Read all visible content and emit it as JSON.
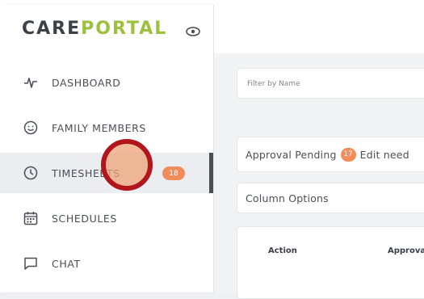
{
  "app": {
    "logo_care": "CARE",
    "logo_portal": "PORTAL",
    "brand_colors": {
      "care": "#3b4148",
      "portal": "#9cc13d"
    }
  },
  "sidebar": {
    "toggle_icon": "eye-icon",
    "items": [
      {
        "label": "DASHBOARD",
        "icon": "pulse-icon",
        "active": false
      },
      {
        "label": "FAMILY MEMBERS",
        "icon": "smiley-icon",
        "active": false
      },
      {
        "label": "TIMESHEETS",
        "icon": "clock-icon",
        "active": true,
        "badge": "18"
      },
      {
        "label": "SCHEDULES",
        "icon": "calendar-icon",
        "active": false
      },
      {
        "label": "CHAT",
        "icon": "chat-bubble-icon",
        "active": false
      }
    ],
    "badge_color": "#f28c5b"
  },
  "main": {
    "filter": {
      "placeholder": "Filter by Name",
      "value": ""
    },
    "status": {
      "approval_pending_label": "Approval Pending",
      "approval_pending_count": "17",
      "edit_label": "Edit need"
    },
    "column_options_label": "Column Options",
    "table": {
      "headers": [
        "Action",
        "Approva"
      ]
    }
  }
}
